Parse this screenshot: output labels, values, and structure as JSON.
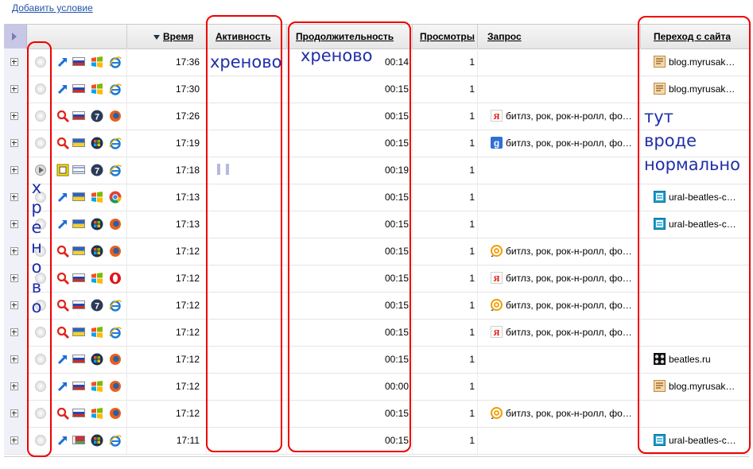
{
  "toolbar": {
    "add_condition": "Добавить условие"
  },
  "table": {
    "columns": {
      "time": "Время",
      "activity": "Активность",
      "duration": "Продолжительность",
      "views": "Просмотры",
      "query": "Запрос",
      "referrer": "Переход с сайта"
    },
    "rows": [
      {
        "activity": "idle",
        "source": "direct-arrow-icon",
        "country": "ru",
        "os": "windows-xp-icon",
        "browser": "ie-icon",
        "time": "17:36",
        "paused": false,
        "duration": "00:14",
        "views": "1",
        "query_engine": "",
        "query": "",
        "referrer_icon": "blog-favicon",
        "referrer": "blog.myrusak…"
      },
      {
        "activity": "idle",
        "source": "direct-arrow-icon",
        "country": "ru",
        "os": "windows-xp-icon",
        "browser": "ie-icon",
        "time": "17:30",
        "paused": false,
        "duration": "00:15",
        "views": "1",
        "query_engine": "",
        "query": "",
        "referrer_icon": "blog-favicon",
        "referrer": "blog.myrusak…"
      },
      {
        "activity": "idle",
        "source": "search-magnifier-icon",
        "country": "ru",
        "os": "windows-7-icon",
        "browser": "firefox-icon",
        "time": "17:26",
        "paused": false,
        "duration": "00:15",
        "views": "1",
        "query_engine": "yandex-icon",
        "query": "битлз, рок, рок-н-ролл, фо…",
        "referrer_icon": "",
        "referrer": ""
      },
      {
        "activity": "idle",
        "source": "search-magnifier-icon",
        "country": "ua",
        "os": "windows-vista-icon",
        "browser": "ie-icon",
        "time": "17:19",
        "paused": false,
        "duration": "00:15",
        "views": "1",
        "query_engine": "google-icon",
        "query": "битлз, рок, рок-н-ролл, фо…",
        "referrer_icon": "",
        "referrer": ""
      },
      {
        "activity": "play",
        "source": "window-icon",
        "country": "il",
        "os": "windows-7-icon",
        "browser": "ie-icon",
        "time": "17:18",
        "paused": true,
        "duration": "00:19",
        "views": "1",
        "query_engine": "",
        "query": "",
        "referrer_icon": "",
        "referrer": ""
      },
      {
        "activity": "idle",
        "source": "direct-arrow-icon",
        "country": "ua",
        "os": "windows-xp-icon",
        "browser": "chrome-icon",
        "time": "17:13",
        "paused": false,
        "duration": "00:15",
        "views": "1",
        "query_engine": "",
        "query": "",
        "referrer_icon": "site-favicon",
        "referrer": "ural-beatles-c…"
      },
      {
        "activity": "idle",
        "source": "direct-arrow-icon",
        "country": "ua",
        "os": "windows-vista-icon",
        "browser": "firefox-icon",
        "time": "17:13",
        "paused": false,
        "duration": "00:15",
        "views": "1",
        "query_engine": "",
        "query": "",
        "referrer_icon": "site-favicon",
        "referrer": "ural-beatles-c…"
      },
      {
        "activity": "idle",
        "source": "search-magnifier-icon",
        "country": "ua",
        "os": "windows-vista-icon",
        "browser": "firefox-icon",
        "time": "17:12",
        "paused": false,
        "duration": "00:15",
        "views": "1",
        "query_engine": "mail-ru-icon",
        "query": "битлз, рок, рок-н-ролл, фо…",
        "referrer_icon": "",
        "referrer": ""
      },
      {
        "activity": "idle",
        "source": "search-magnifier-icon",
        "country": "ru",
        "os": "windows-xp-icon",
        "browser": "opera-icon",
        "time": "17:12",
        "paused": false,
        "duration": "00:15",
        "views": "1",
        "query_engine": "yandex-icon",
        "query": "битлз, рок, рок-н-ролл, фо…",
        "referrer_icon": "",
        "referrer": ""
      },
      {
        "activity": "idle",
        "source": "search-magnifier-icon",
        "country": "ru",
        "os": "windows-7-icon",
        "browser": "ie-icon",
        "time": "17:12",
        "paused": false,
        "duration": "00:15",
        "views": "1",
        "query_engine": "mail-ru-icon",
        "query": "битлз, рок, рок-н-ролл, фо…",
        "referrer_icon": "",
        "referrer": ""
      },
      {
        "activity": "idle",
        "source": "search-magnifier-icon",
        "country": "ua",
        "os": "windows-xp-icon",
        "browser": "ie-icon",
        "time": "17:12",
        "paused": false,
        "duration": "00:15",
        "views": "1",
        "query_engine": "yandex-icon",
        "query": "битлз, рок, рок-н-ролл, фо…",
        "referrer_icon": "",
        "referrer": ""
      },
      {
        "activity": "idle",
        "source": "direct-arrow-icon",
        "country": "ru",
        "os": "windows-vista-icon",
        "browser": "firefox-icon",
        "time": "17:12",
        "paused": false,
        "duration": "00:15",
        "views": "1",
        "query_engine": "",
        "query": "",
        "referrer_icon": "beatles-favicon",
        "referrer": "beatles.ru"
      },
      {
        "activity": "idle",
        "source": "direct-arrow-icon",
        "country": "ru",
        "os": "windows-xp-icon",
        "browser": "firefox-icon",
        "time": "17:12",
        "paused": false,
        "duration": "00:00",
        "views": "1",
        "query_engine": "",
        "query": "",
        "referrer_icon": "blog-favicon",
        "referrer": "blog.myrusak…"
      },
      {
        "activity": "idle",
        "source": "search-magnifier-icon",
        "country": "ru",
        "os": "windows-xp-icon",
        "browser": "firefox-icon",
        "time": "17:12",
        "paused": false,
        "duration": "00:15",
        "views": "1",
        "query_engine": "mail-ru-icon",
        "query": "битлз, рок, рок-н-ролл, фо…",
        "referrer_icon": "",
        "referrer": ""
      },
      {
        "activity": "idle",
        "source": "direct-arrow-icon",
        "country": "by",
        "os": "windows-vista-icon",
        "browser": "ie-icon",
        "time": "17:11",
        "paused": false,
        "duration": "00:15",
        "views": "1",
        "query_engine": "",
        "query": "",
        "referrer_icon": "site-favicon",
        "referrer": "ural-beatles-c…"
      }
    ]
  },
  "annotations": {
    "activity_note": "хреново",
    "duration_note": "хреново",
    "vertical_note": "х р е н о в о",
    "referrer_note": "тут\nвроде\nнормально"
  },
  "colors": {
    "annotation_outline": "#e00000",
    "handwriting": "#1f2fa8",
    "link": "#2255aa"
  }
}
